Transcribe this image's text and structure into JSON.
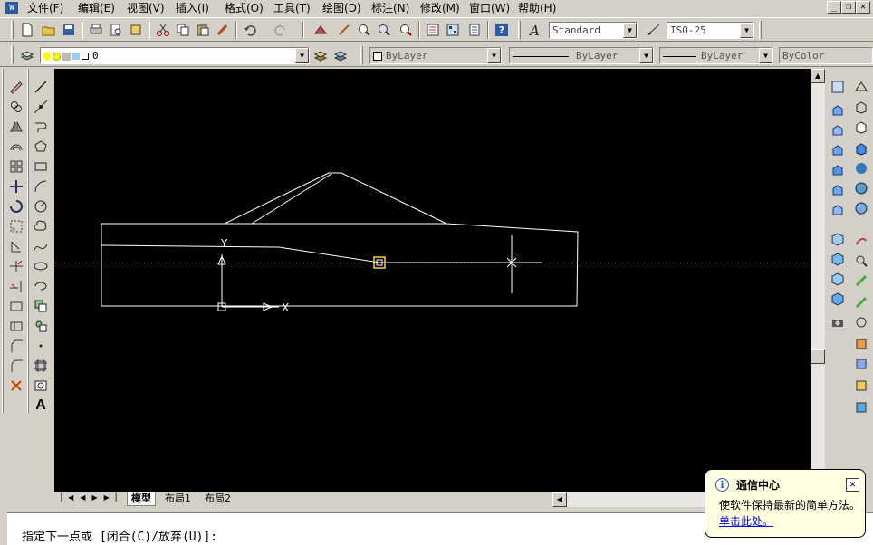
{
  "menubar": {
    "items": [
      "文件(F)",
      "编辑(E)",
      "视图(V)",
      "插入(I)",
      "格式(O)",
      "工具(T)",
      "绘图(D)",
      "标注(N)",
      "修改(M)",
      "窗口(W)",
      "帮助(H)"
    ],
    "app_icon": "cad-app-icon"
  },
  "toolbar": {
    "text_style": "Standard",
    "dim_style": "ISO-25",
    "layer": "0",
    "color": "ByLayer",
    "linetype": "ByLayer",
    "lineweight": "ByLayer",
    "plotstyle": "ByColor"
  },
  "text_tool_glyph": "A",
  "canvas": {
    "background": "#000000",
    "line_color": "#ffffff",
    "ucs_x_label": "X",
    "ucs_y_label": "Y"
  },
  "layout_tabs": [
    "模型",
    "布局1",
    "布局2"
  ],
  "command": {
    "prompt": "指定下一点或 [闭合(C)/放弃(U)]:"
  },
  "balloon": {
    "title": "通信中心",
    "message": "使软件保持最新的简单方法。",
    "link": "单击此处。",
    "close": "✕",
    "info": "i"
  },
  "window_controls": [
    "_",
    "❐",
    "✕"
  ]
}
